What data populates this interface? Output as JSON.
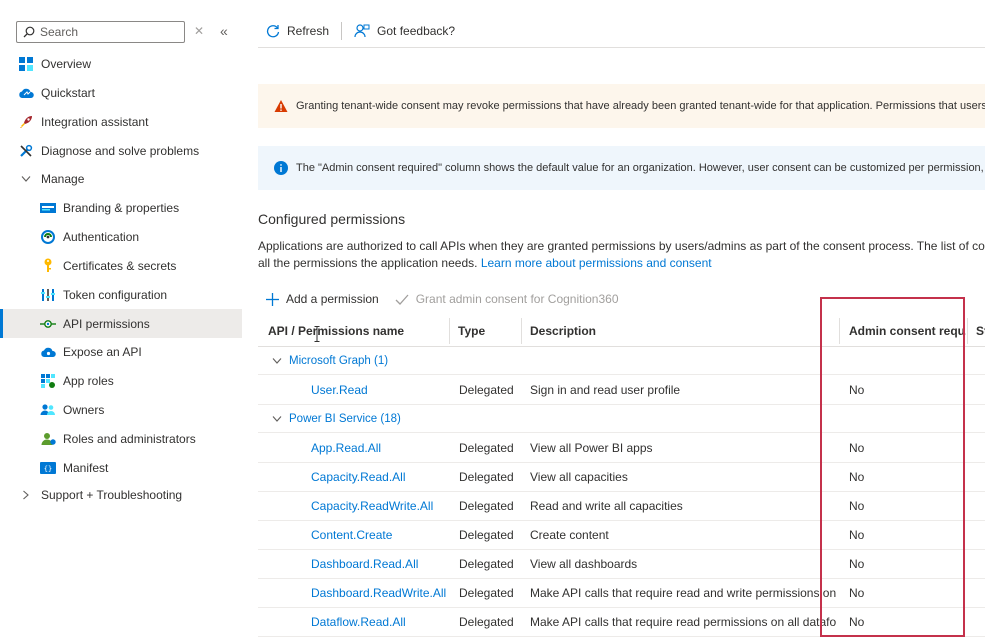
{
  "sidebar": {
    "search_placeholder": "Search",
    "clear_glyph": "✕",
    "collapse_glyph": "«",
    "items": [
      {
        "label": "Overview",
        "icon": "overview-grid-icon",
        "level": 1
      },
      {
        "label": "Quickstart",
        "icon": "cloud-quickstart-icon",
        "level": 1
      },
      {
        "label": "Integration assistant",
        "icon": "rocket-icon",
        "level": 1
      },
      {
        "label": "Diagnose and solve problems",
        "icon": "wrench-icon",
        "level": 1
      },
      {
        "label": "Manage",
        "icon": "chevron-down-icon",
        "level": 1,
        "expanded": true
      },
      {
        "label": "Branding & properties",
        "icon": "branding-icon",
        "level": 2
      },
      {
        "label": "Authentication",
        "icon": "authentication-icon",
        "level": 2
      },
      {
        "label": "Certificates & secrets",
        "icon": "key-icon",
        "level": 2
      },
      {
        "label": "Token configuration",
        "icon": "token-bars-icon",
        "level": 2
      },
      {
        "label": "API permissions",
        "icon": "api-permissions-icon",
        "level": 2,
        "active": true
      },
      {
        "label": "Expose an API",
        "icon": "cloud-api-icon",
        "level": 2
      },
      {
        "label": "App roles",
        "icon": "app-roles-grid-icon",
        "level": 2
      },
      {
        "label": "Owners",
        "icon": "owners-people-icon",
        "level": 2
      },
      {
        "label": "Roles and administrators",
        "icon": "roles-admin-icon",
        "level": 2
      },
      {
        "label": "Manifest",
        "icon": "manifest-icon",
        "level": 2
      },
      {
        "label": "Support + Troubleshooting",
        "icon": "chevron-right-icon",
        "level": 1,
        "expanded": false
      }
    ]
  },
  "toolbar": {
    "refresh_label": "Refresh",
    "feedback_label": "Got feedback?"
  },
  "banners": {
    "warning_text": "Granting tenant-wide consent may revoke permissions that have already been granted tenant-wide for that application. Permissions that users ha",
    "info_text": "The \"Admin consent required\" column shows the default value for an organization. However, user consent can be customized per permission, use"
  },
  "configured": {
    "title": "Configured permissions",
    "desc_line1": "Applications are authorized to call APIs when they are granted permissions by users/admins as part of the consent process. The list of configu",
    "desc_line2": "all the permissions the application needs.",
    "learn_more": "Learn more about permissions and consent",
    "add_permission": "Add a permission",
    "grant_consent": "Grant admin consent for Cognition360"
  },
  "table": {
    "columns": [
      "API / Permissions name",
      "Type",
      "Description",
      "Admin consent requ...",
      "St"
    ],
    "groups": [
      {
        "label": "Microsoft Graph (1)",
        "rows": [
          {
            "name": "User.Read",
            "type": "Delegated",
            "description": "Sign in and read user profile",
            "admin": "No"
          }
        ]
      },
      {
        "label": "Power BI Service (18)",
        "rows": [
          {
            "name": "App.Read.All",
            "type": "Delegated",
            "description": "View all Power BI apps",
            "admin": "No"
          },
          {
            "name": "Capacity.Read.All",
            "type": "Delegated",
            "description": "View all capacities",
            "admin": "No"
          },
          {
            "name": "Capacity.ReadWrite.All",
            "type": "Delegated",
            "description": "Read and write all capacities",
            "admin": "No"
          },
          {
            "name": "Content.Create",
            "type": "Delegated",
            "description": "Create content",
            "admin": "No"
          },
          {
            "name": "Dashboard.Read.All",
            "type": "Delegated",
            "description": "View all dashboards",
            "admin": "No"
          },
          {
            "name": "Dashboard.ReadWrite.All",
            "type": "Delegated",
            "description": "Make API calls that require read and write permissions on ...",
            "admin": "No"
          },
          {
            "name": "Dataflow.Read.All",
            "type": "Delegated",
            "description": "Make API calls that require read permissions on all datafo...",
            "admin": "No"
          }
        ]
      }
    ]
  },
  "colors": {
    "accent": "#0078d4",
    "highlight": "#c4314b",
    "warning": "#d83b01",
    "info": "#0078d4"
  }
}
